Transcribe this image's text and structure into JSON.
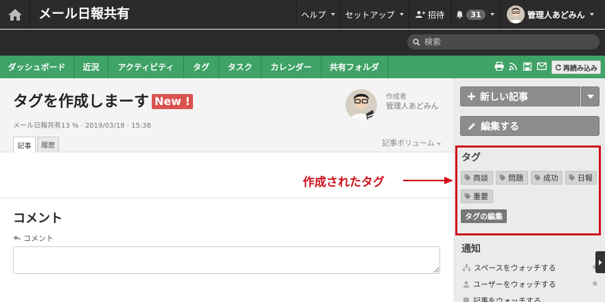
{
  "header": {
    "app_title": "メール日報共有",
    "menus": [
      "ヘルプ",
      "セットアップ"
    ],
    "invite_label": "招待",
    "notification_count": "31",
    "user_name": "管理人あどみん"
  },
  "search": {
    "placeholder": "検索"
  },
  "nav": {
    "items": [
      "ダッシュボード",
      "近況",
      "アクティビティ",
      "タグ",
      "タスク",
      "カレンダー",
      "共有フォルダ"
    ],
    "reread_label": "再読み込み"
  },
  "article": {
    "title": "タグを作成しまーす",
    "new_badge": "New !",
    "meta": "メール日報共有13 % · 2019/03/18 · 15:38",
    "author_label": "作成者",
    "author_name": "管理人あどみん",
    "tabs": [
      "記事",
      "履歴"
    ],
    "volume_label": "記事ボリューム"
  },
  "comment": {
    "title": "コメント",
    "label": "コメント"
  },
  "sidebar": {
    "new_article": "新しい記事",
    "edit": "編集する",
    "tags_heading": "タグ",
    "tags": [
      "商談",
      "問題",
      "成功",
      "日報",
      "重要"
    ],
    "tag_edit": "タグの編集",
    "notify_heading": "通知",
    "watch_items": [
      "スペースをウォッチする",
      "ユーザーをウォッチする",
      "記事をウォッチする"
    ]
  },
  "annotation": {
    "text": "作成されたタグ",
    "color": "#d0101a"
  },
  "colors": {
    "nav_green": "#3fa266",
    "topbar": "#2b2b2b",
    "highlight": "#d0101a"
  }
}
